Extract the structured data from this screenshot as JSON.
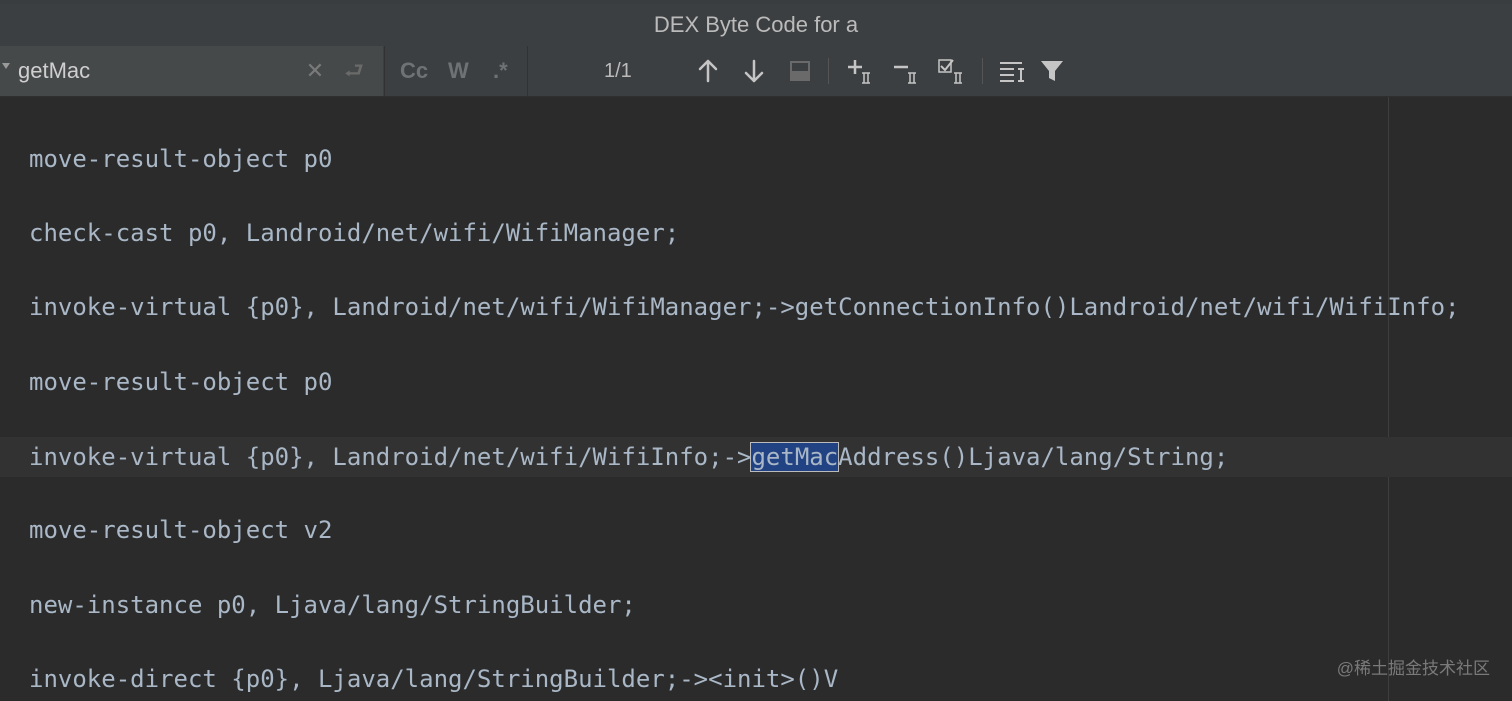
{
  "window": {
    "title": "DEX Byte Code for a"
  },
  "search": {
    "value": "getMac",
    "clear_icon": "close-icon",
    "enter_icon": "return-icon",
    "options": {
      "match_case": "Cc",
      "words": "W",
      "regex": ".*"
    },
    "match_count": "1/1"
  },
  "code": {
    "lines": [
      "move-result-object p0",
      "check-cast p0, Landroid/net/wifi/WifiManager;",
      "invoke-virtual {p0}, Landroid/net/wifi/WifiManager;->getConnectionInfo()Landroid/net/wifi/WifiInfo;",
      "move-result-object p0",
      "invoke-virtual {p0}, Landroid/net/wifi/WifiInfo;->getMacAddress()Ljava/lang/String;",
      "move-result-object v2",
      "new-instance p0, Ljava/lang/StringBuilder;",
      "invoke-direct {p0}, Ljava/lang/StringBuilder;-><init>()V"
    ],
    "highlight": {
      "line_index": 4,
      "before": "invoke-virtual {p0}, Landroid/net/wifi/WifiInfo;->",
      "match": "getMac",
      "after": "Address()Ljava/lang/String;"
    }
  },
  "watermark": "@稀土掘金技术社区",
  "colors": {
    "editor_bg": "#2b2b2b",
    "toolbar_bg": "#3c3f41",
    "code_text": "#a9b7c6",
    "match_highlight": "#214283"
  }
}
